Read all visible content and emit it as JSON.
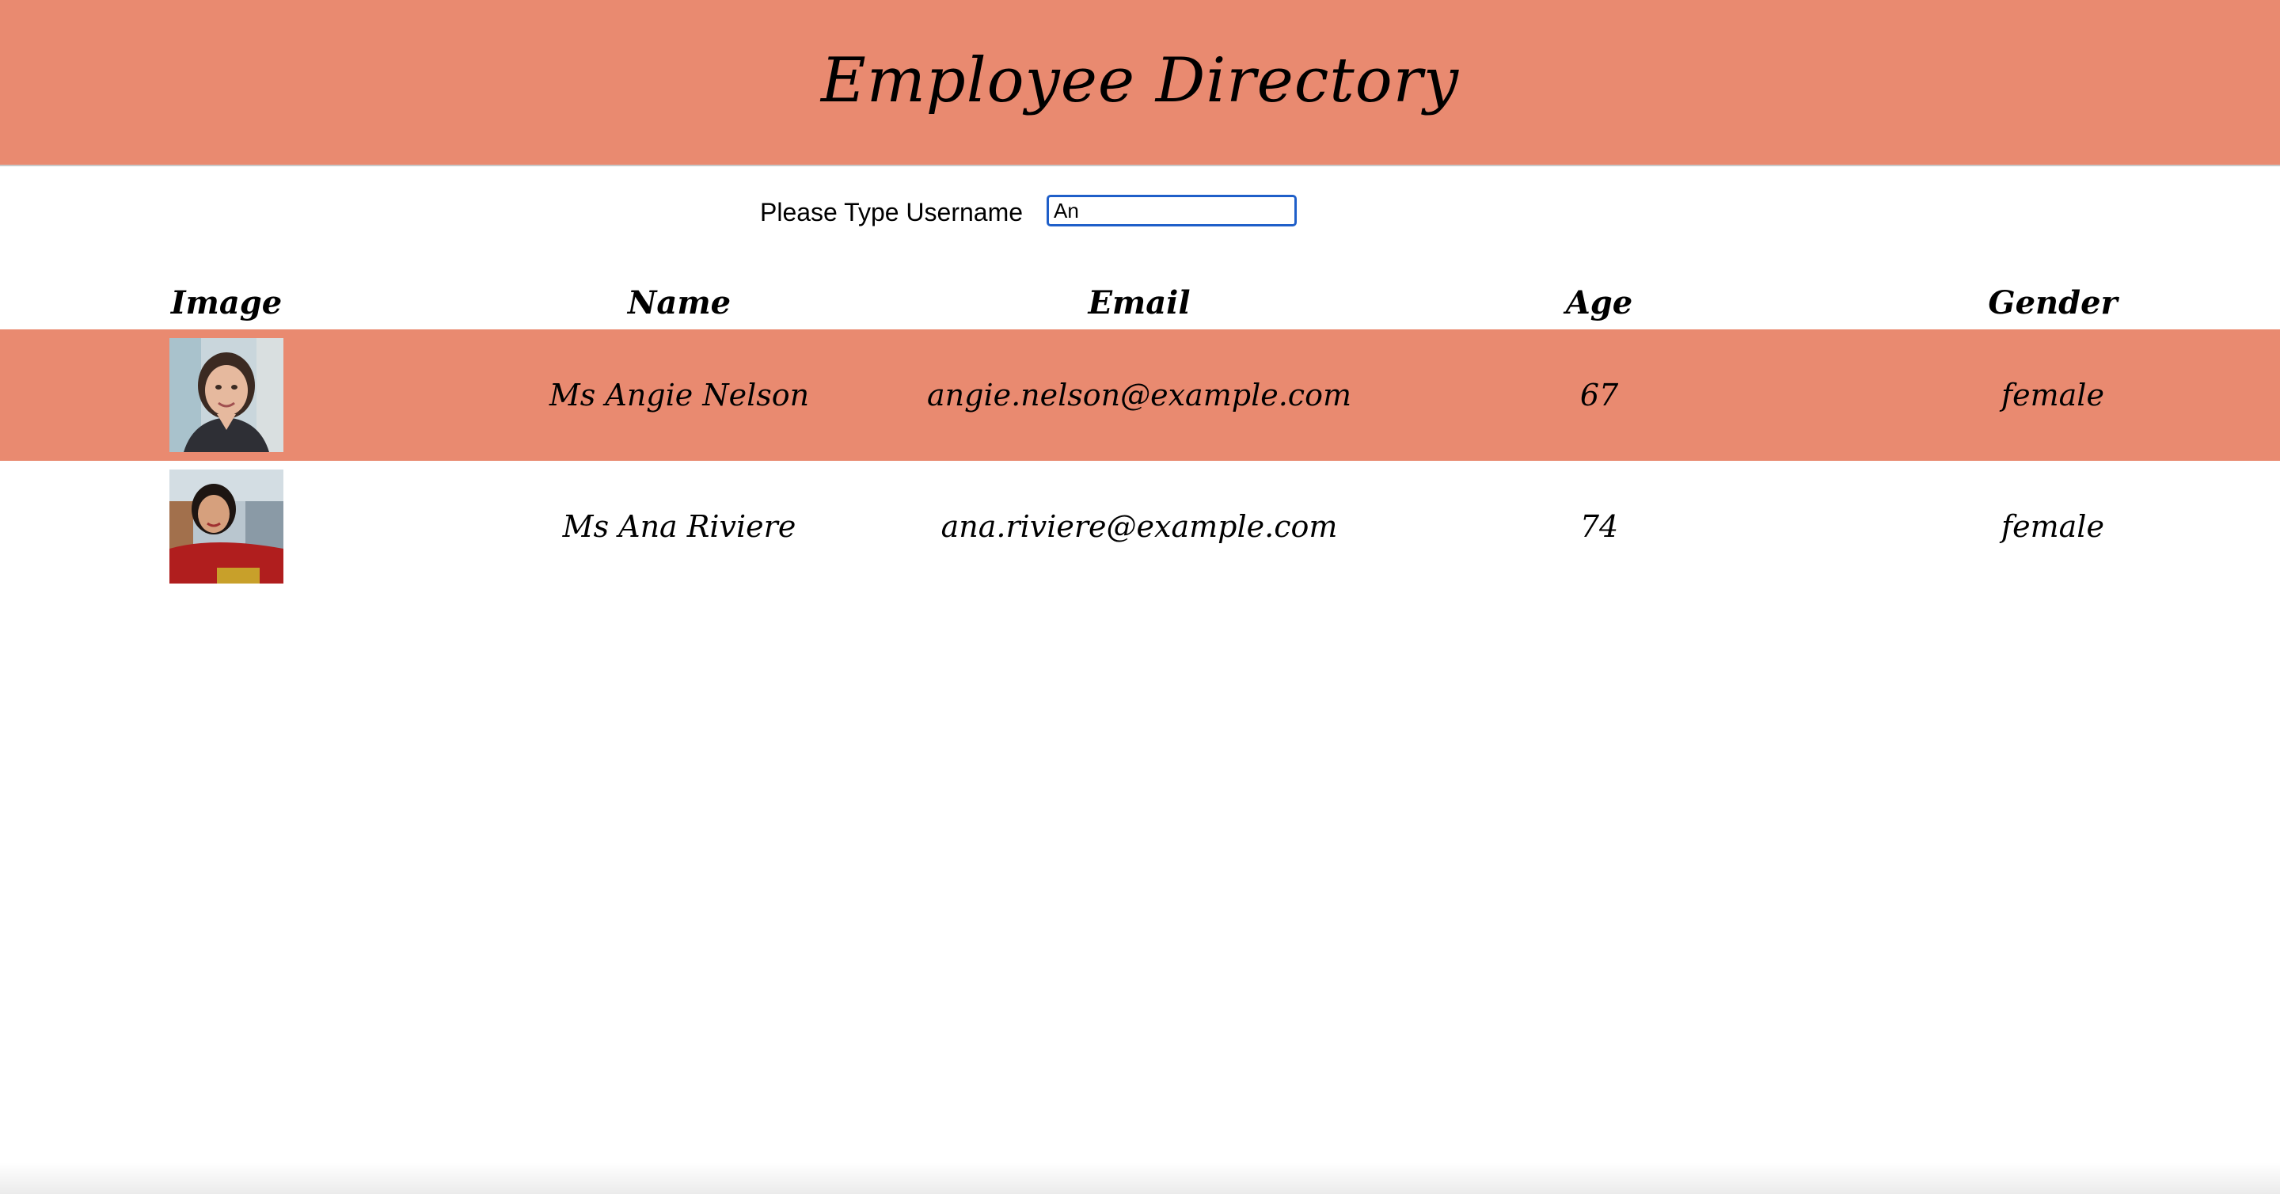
{
  "header": {
    "title": "Employee Directory",
    "bg_color": "#E98A70"
  },
  "search": {
    "label": "Please Type Username",
    "value": "An"
  },
  "table": {
    "columns": [
      "Image",
      "Name",
      "Email",
      "Age",
      "Gender"
    ],
    "rows": [
      {
        "image": "employee-photo",
        "name": "Ms Angie Nelson",
        "email": "angie.nelson@example.com",
        "age": "67",
        "gender": "female",
        "highlighted": true
      },
      {
        "image": "employee-photo",
        "name": "Ms Ana Riviere",
        "email": "ana.riviere@example.com",
        "age": "74",
        "gender": "female",
        "highlighted": false
      }
    ]
  }
}
